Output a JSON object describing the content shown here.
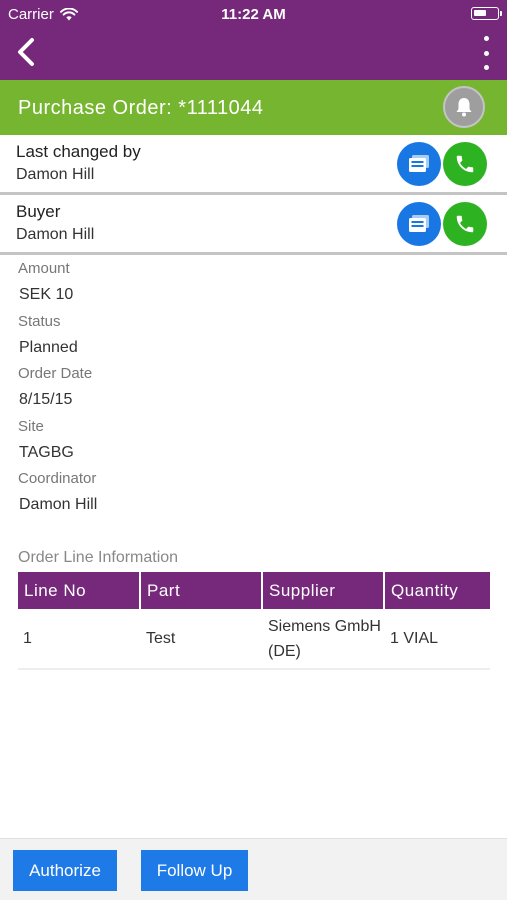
{
  "status_bar": {
    "carrier": "Carrier",
    "time": "11:22 AM"
  },
  "header": {
    "title": "Purchase Order: *1111044"
  },
  "contacts": [
    {
      "label": "Last changed by",
      "name": "Damon Hill"
    },
    {
      "label": "Buyer",
      "name": "Damon Hill"
    }
  ],
  "details": [
    {
      "label": "Amount",
      "value": "SEK 10"
    },
    {
      "label": "Status",
      "value": "Planned"
    },
    {
      "label": "Order Date",
      "value": "8/15/15"
    },
    {
      "label": "Site",
      "value": "TAGBG"
    },
    {
      "label": "Coordinator",
      "value": "Damon Hill"
    }
  ],
  "order_lines": {
    "title": "Order Line Information",
    "columns": [
      "Line No",
      "Part",
      "Supplier",
      "Quantity"
    ],
    "rows": [
      [
        "1",
        "Test",
        "Siemens GmbH (DE)",
        "1 VIAL"
      ]
    ]
  },
  "actions": {
    "authorize": "Authorize",
    "follow_up": "Follow Up"
  },
  "colors": {
    "nav": "#76297a",
    "header": "#76b530",
    "primary": "#1e7ae6",
    "phone": "#2db322"
  }
}
